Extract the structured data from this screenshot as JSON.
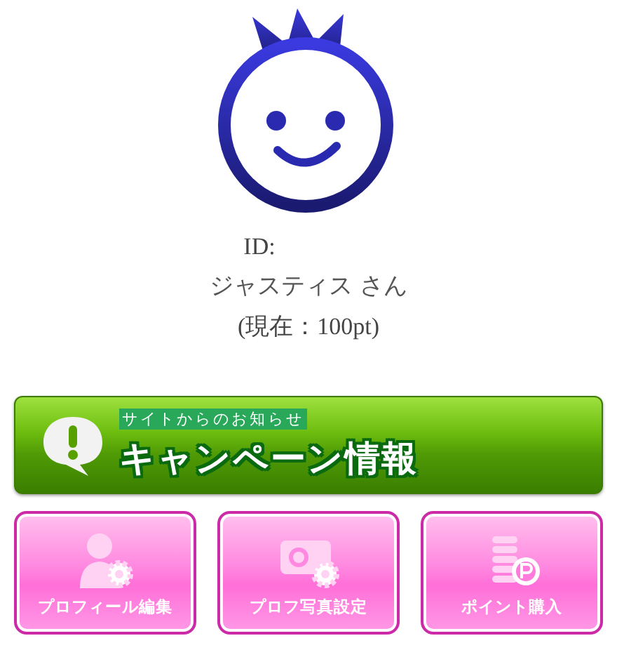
{
  "profile": {
    "id_label": "ID:",
    "name": "ジャスティス さん",
    "points": "(現在：100pt)"
  },
  "banner": {
    "subtitle": "サイトからのお知らせ",
    "title": "キャンペーン情報"
  },
  "buttons": [
    {
      "kind": "profile",
      "label": "プロフィール編集"
    },
    {
      "kind": "photo",
      "label": "プロフ写真設定"
    },
    {
      "kind": "points",
      "label": "ポイント購入"
    }
  ]
}
